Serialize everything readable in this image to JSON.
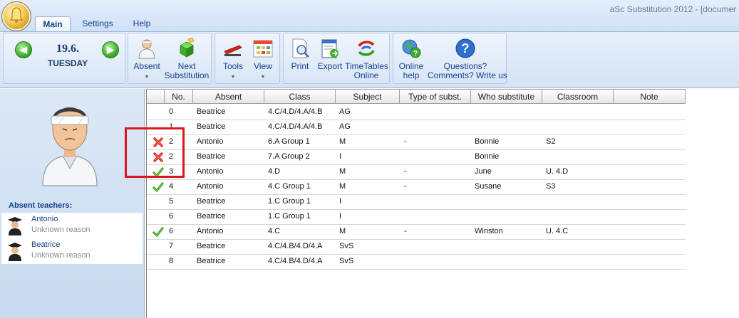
{
  "window": {
    "title": "aSc Substitution 2012 - [documer"
  },
  "tabs": [
    {
      "label": "Main",
      "active": true
    },
    {
      "label": "Settings",
      "active": false
    },
    {
      "label": "Help",
      "active": false
    }
  ],
  "ribbon": {
    "date": "19.6.",
    "day": "TUESDAY",
    "absent_label": "Absent",
    "next_sub_line1": "Next",
    "next_sub_line2": "Substitution",
    "tools_label": "Tools",
    "view_label": "View",
    "print_label": "Print",
    "export_label": "Export",
    "timetables_line1": "TimeTables",
    "timetables_line2": "Online",
    "online_help_line1": "Online",
    "online_help_line2": "help",
    "questions_line1": "Questions?",
    "questions_line2": "Comments? Write us"
  },
  "left_panel": {
    "absent_header": "Absent teachers:",
    "teachers": [
      {
        "name": "Antonio",
        "reason": "Unknown reason"
      },
      {
        "name": "Beatrice",
        "reason": "Unknown reason"
      }
    ]
  },
  "grid": {
    "columns": [
      "No.",
      "Absent",
      "Class",
      "Subject",
      "Type of subst.",
      "Who substitute",
      "Classroom",
      "Note"
    ],
    "rows": [
      {
        "mark": "none",
        "no": "0",
        "absent": "Beatrice",
        "class": "4.C/4.D/4.A/4.B",
        "subject": "AG",
        "type": "",
        "who": "",
        "room": ""
      },
      {
        "mark": "none",
        "no": "1",
        "absent": "Beatrice",
        "class": "4.C/4.D/4.A/4.B",
        "subject": "AG",
        "type": "",
        "who": "",
        "room": ""
      },
      {
        "mark": "cross",
        "no": "2",
        "absent": "Antonio",
        "class": "6.A Group 1",
        "subject": "M",
        "type": "-",
        "who": "Bonnie",
        "room": "S2"
      },
      {
        "mark": "cross",
        "no": "2",
        "absent": "Beatrice",
        "class": "7.A Group 2",
        "subject": "I",
        "type": "",
        "who": "Bonnie",
        "room": ""
      },
      {
        "mark": "check",
        "no": "3",
        "absent": "Antonio",
        "class": "4.D",
        "subject": "M",
        "type": "-",
        "who": "June",
        "room": "U. 4.D"
      },
      {
        "mark": "check",
        "no": "4",
        "absent": "Antonio",
        "class": "4.C Group 1",
        "subject": "M",
        "type": "-",
        "who": "Susane",
        "room": "S3"
      },
      {
        "mark": "none",
        "no": "5",
        "absent": "Beatrice",
        "class": "1.C Group 1",
        "subject": "I",
        "type": "",
        "who": "",
        "room": ""
      },
      {
        "mark": "none",
        "no": "6",
        "absent": "Beatrice",
        "class": "1.C Group 1",
        "subject": "I",
        "type": "",
        "who": "",
        "room": ""
      },
      {
        "mark": "check",
        "no": "6",
        "absent": "Antonio",
        "class": "4.C",
        "subject": "M",
        "type": "-",
        "who": "Winston",
        "room": "U. 4.C"
      },
      {
        "mark": "none",
        "no": "7",
        "absent": "Beatrice",
        "class": "4.C/4.B/4.D/4.A",
        "subject": "SvS",
        "type": "",
        "who": "",
        "room": ""
      },
      {
        "mark": "none",
        "no": "8",
        "absent": "Beatrice",
        "class": "4.C/4.B/4.D/4.A",
        "subject": "SvS",
        "type": "",
        "who": "",
        "room": ""
      }
    ]
  },
  "colors": {
    "accent": "#15428b",
    "highlight": "#d9161b"
  }
}
